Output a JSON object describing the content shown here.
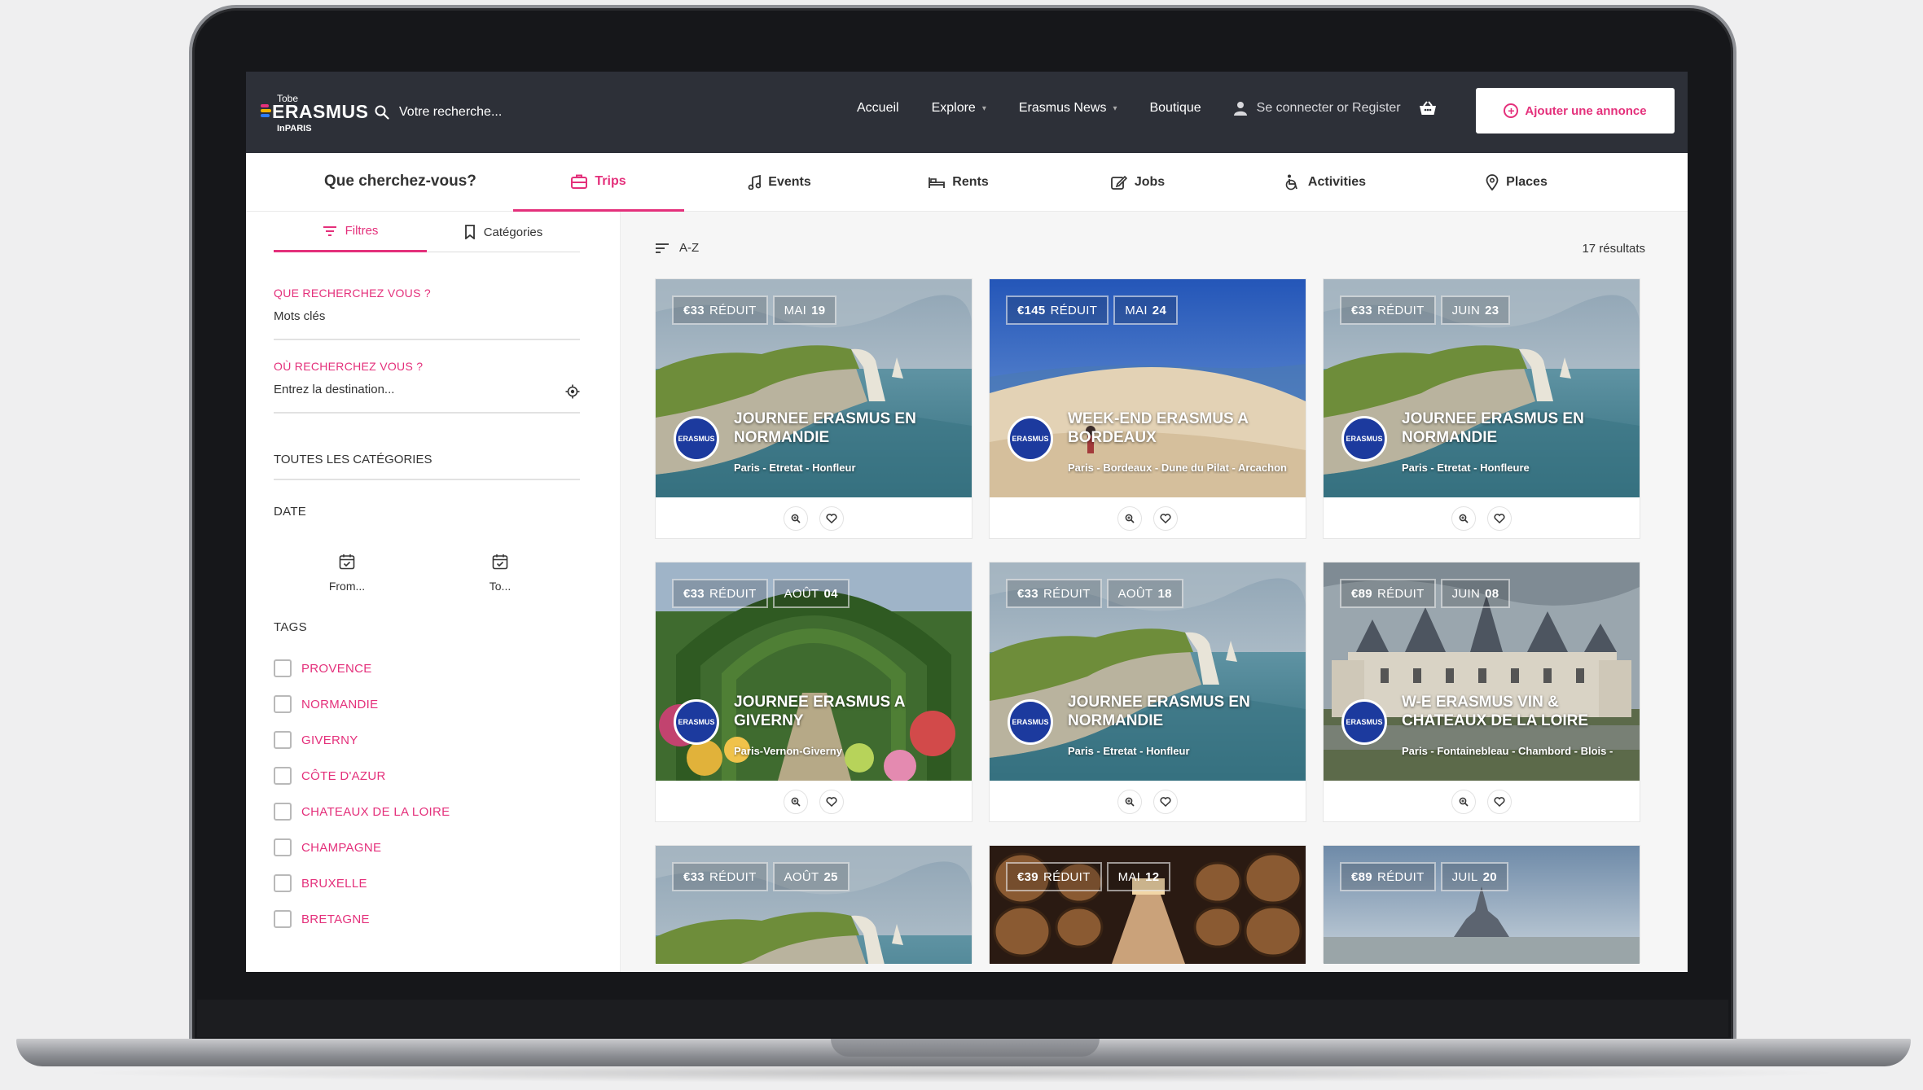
{
  "header": {
    "logo_top": "Tobe",
    "logo_name": "ERASMUS",
    "logo_sub": "InPARIS",
    "search_placeholder": "Votre recherche...",
    "nav": [
      {
        "label": "Accueil"
      },
      {
        "label": "Explore",
        "caret": "▾"
      },
      {
        "label": "Erasmus News",
        "caret": "▾"
      },
      {
        "label": "Boutique"
      }
    ],
    "login_label": "Se connecter or Register",
    "add_button_label": "Ajouter une annonce"
  },
  "category_bar": {
    "question": "Que cherchez-vous?",
    "tabs": [
      {
        "label": "Trips",
        "icon": "briefcase-icon",
        "active": true
      },
      {
        "label": "Events",
        "icon": "music-note-icon"
      },
      {
        "label": "Rents",
        "icon": "bed-icon"
      },
      {
        "label": "Jobs",
        "icon": "edit-icon"
      },
      {
        "label": "Activities",
        "icon": "wheelchair-icon"
      },
      {
        "label": "Places",
        "icon": "map-pin-icon"
      }
    ]
  },
  "sidebar": {
    "tabs": [
      {
        "label": "Filtres",
        "icon": "filter-icon",
        "active": true
      },
      {
        "label": "Catégories",
        "icon": "bookmark-icon"
      }
    ],
    "keyword": {
      "label": "QUE RECHERCHEZ VOUS ?",
      "value": "Mots clés"
    },
    "destination": {
      "label": "OÙ RECHERCHEZ VOUS ?",
      "value": "Entrez la destination..."
    },
    "all_categories": "TOUTES LES CATÉGORIES",
    "date_title": "DATE",
    "date_from": "From...",
    "date_to": "To...",
    "tags_title": "TAGS",
    "tags": [
      "PROVENCE",
      "NORMANDIE",
      "GIVERNY",
      "CÔTE D'AZUR",
      "CHATEAUX DE LA LOIRE",
      "CHAMPAGNE",
      "BRUXELLE",
      "BRETAGNE"
    ]
  },
  "results": {
    "sort_label": "A-Z",
    "count_label": "17 résultats",
    "cards": [
      {
        "price": "€33",
        "price_label": "RÉDUIT",
        "date": "MAI",
        "day": "19",
        "title": "JOURNEE ERASMUS EN NORMANDIE",
        "route": "Paris - Etretat - Honfleur",
        "scene": "cliff"
      },
      {
        "price": "€145",
        "price_label": "RÉDUIT",
        "date": "MAI",
        "day": "24",
        "title": "WEEK-END ERASMUS A BORDEAUX",
        "route": "Paris - Bordeaux - Dune du Pilat - Arcachon",
        "scene": "dune"
      },
      {
        "price": "€33",
        "price_label": "RÉDUIT",
        "date": "JUIN",
        "day": "23",
        "title": "JOURNEE ERASMUS EN NORMANDIE",
        "route": "Paris - Etretat - Honfleure",
        "scene": "cliff"
      },
      {
        "price": "€33",
        "price_label": "RÉDUIT",
        "date": "AOÛT",
        "day": "04",
        "title": "JOURNEE ERASMUS A GIVERNY",
        "route": "Paris-Vernon-Giverny",
        "scene": "garden"
      },
      {
        "price": "€33",
        "price_label": "RÉDUIT",
        "date": "AOÛT",
        "day": "18",
        "title": "JOURNEE ERASMUS EN NORMANDIE",
        "route": "Paris - Etretat - Honfleur",
        "scene": "cliff"
      },
      {
        "price": "€89",
        "price_label": "RÉDUIT",
        "date": "JUIN",
        "day": "08",
        "title": "W-E ERASMUS VIN & CHATEAUX DE LA LOIRE",
        "route": "Paris - Fontainebleau - Chambord - Blois -",
        "scene": "castle"
      },
      {
        "price": "€33",
        "price_label": "RÉDUIT",
        "date": "AOÛT",
        "day": "25",
        "scene": "cliff"
      },
      {
        "price": "€39",
        "price_label": "RÉDUIT",
        "date": "MAI",
        "day": "12",
        "scene": "cellar"
      },
      {
        "price": "€89",
        "price_label": "RÉDUIT",
        "date": "JUIL",
        "day": "20",
        "scene": "abbey"
      }
    ],
    "org_logo_text": "ERASMUS"
  },
  "colors": {
    "accent": "#e4307b",
    "header_bg": "#2d3038",
    "org_logo": "#1c3a9e"
  }
}
